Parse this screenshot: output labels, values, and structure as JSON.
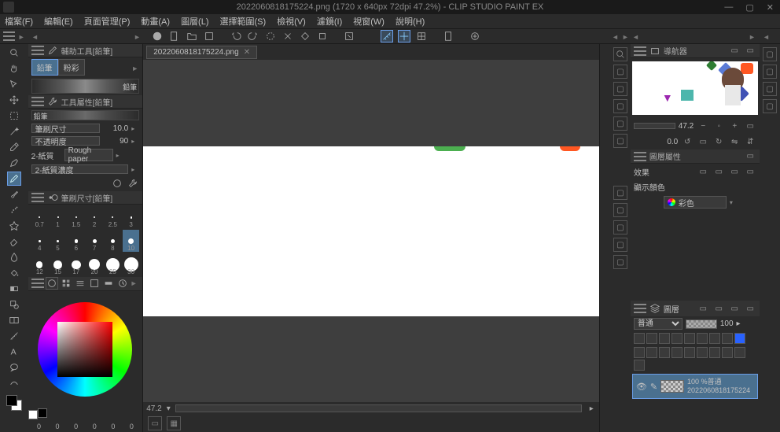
{
  "title": "2022060818175224.png (1720 x 640px 72dpi 47.2%)    - CLIP STUDIO PAINT EX",
  "menu": [
    "檔案(F)",
    "編輯(E)",
    "頁面管理(P)",
    "動畫(A)",
    "圖層(L)",
    "選擇範圍(S)",
    "檢視(V)",
    "濾鏡(I)",
    "視窗(W)",
    "說明(H)"
  ],
  "filetab": "2022060818175224.png",
  "subtool": {
    "header": "輔助工具[鉛筆]",
    "tab1": "鉛筆",
    "tab2": "粉彩",
    "brush_name": "鉛筆"
  },
  "toolprop": {
    "header": "工具屬性[鉛筆]",
    "size_label": "筆刷尺寸",
    "size_value": "10.0",
    "opacity_label": "不透明度",
    "opacity_value": "90",
    "paper_label": "2-紙質",
    "paper_value": "Rough paper",
    "paper_density_label": "2-紙質濃度"
  },
  "brushsize": {
    "header": "筆刷尺寸[鉛筆]",
    "sizes": [
      "0.7",
      "1",
      "1.5",
      "2",
      "2.5",
      "3",
      "4",
      "5",
      "6",
      "7",
      "8",
      "10",
      "12",
      "15",
      "17",
      "20",
      "25",
      "30"
    ],
    "selected_index": 11
  },
  "color": {
    "rgb": [
      "0",
      "0",
      "0",
      "0",
      "0",
      "0"
    ]
  },
  "canvas_footer": {
    "zoom": "47.2"
  },
  "nav": {
    "header": "導航器",
    "zoom": "47.2",
    "angle": "0.0"
  },
  "layerprop": {
    "header": "圖層屬性",
    "effect": "效果",
    "showcolor": "顯示顏色",
    "colormode": "彩色"
  },
  "layers": {
    "header": "圖層",
    "blend": "普通",
    "opacity": "100",
    "item_mode": "100 %普通",
    "item_name": "2022060818175224"
  }
}
